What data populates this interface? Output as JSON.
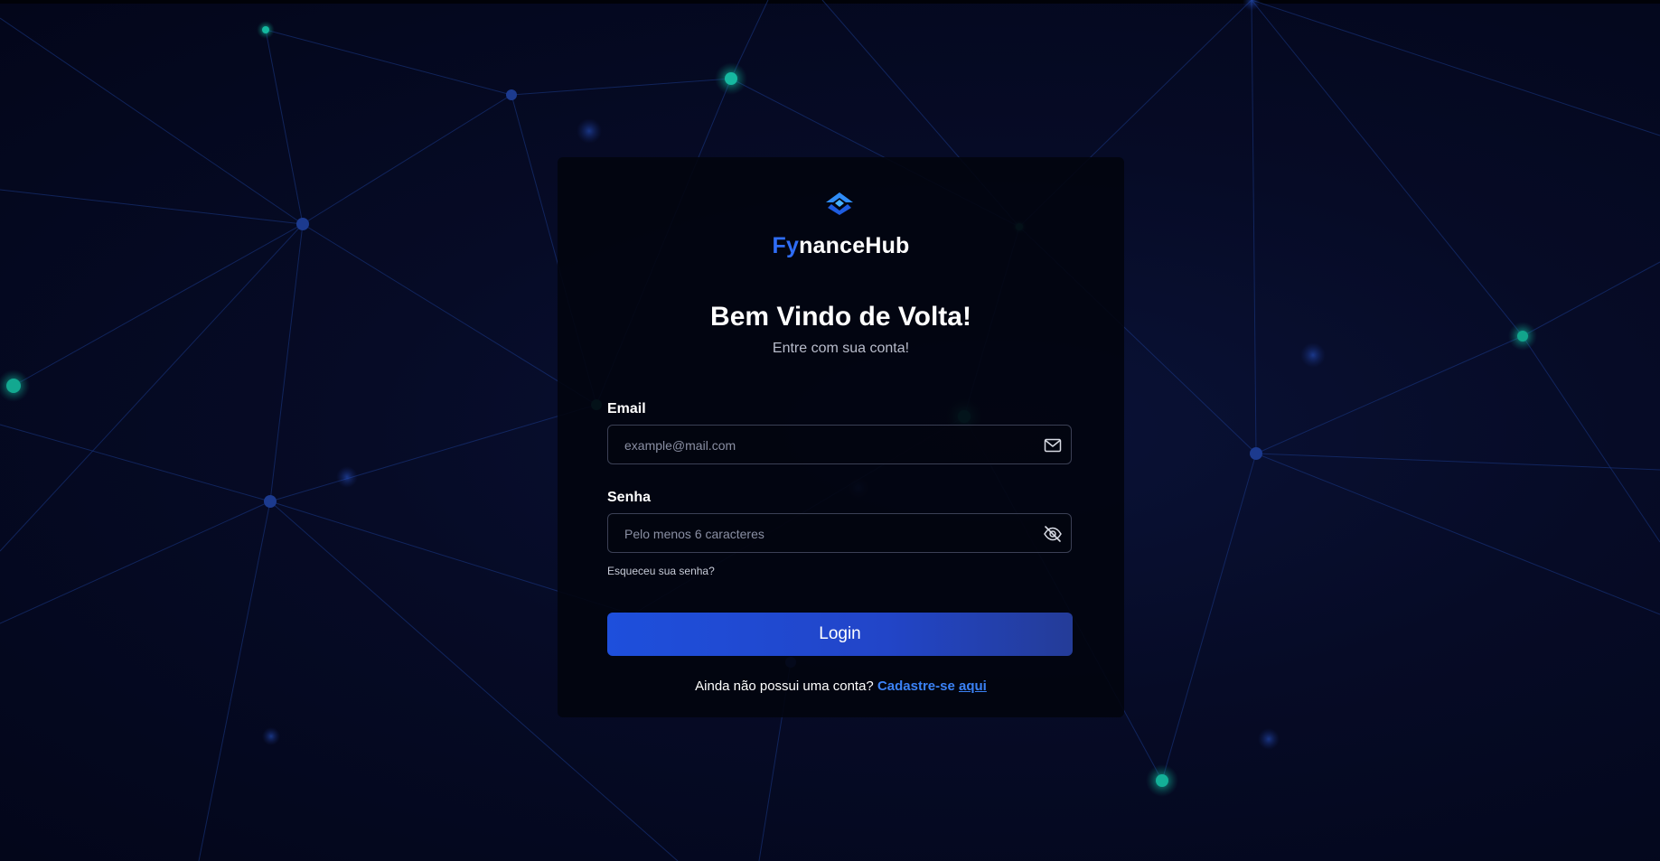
{
  "brand": {
    "prefix": "Fy",
    "suffix": "nanceHub",
    "logo_icon": "chevron-arrow-logo-icon"
  },
  "heading": {
    "title": "Bem Vindo de Volta!",
    "subtitle": "Entre com sua conta!"
  },
  "form": {
    "email": {
      "label": "Email",
      "placeholder": "example@mail.com",
      "value": "",
      "icon": "mail-icon"
    },
    "password": {
      "label": "Senha",
      "placeholder": "Pelo menos 6 caracteres",
      "value": "",
      "icon": "eye-off-icon"
    },
    "forgot_link": "Esqueceu sua senha?",
    "submit_label": "Login"
  },
  "signup": {
    "prompt": "Ainda não possui uma conta?",
    "cta": "Cadastre-se",
    "link": "aqui"
  },
  "colors": {
    "accent": "#2f6df6",
    "button_start": "#1e4fdc",
    "button_end": "#243c98",
    "background": "#04071a",
    "node_glow": "#12c2a8"
  }
}
